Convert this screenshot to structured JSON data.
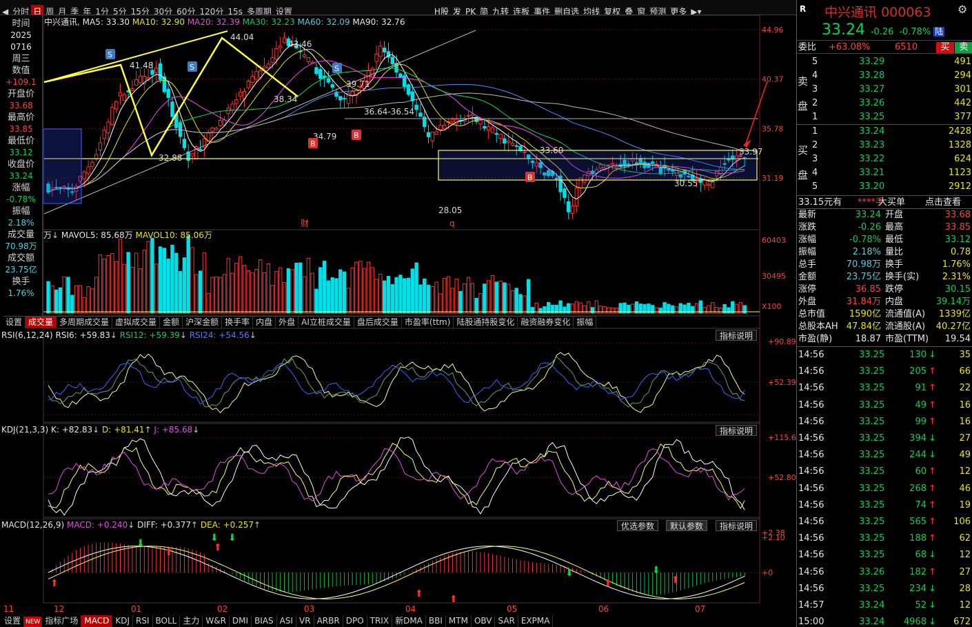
{
  "toolbar": {
    "left": [
      "分时",
      "日",
      "周",
      "月",
      "季",
      "年",
      "1分",
      "5分",
      "15分",
      "30分",
      "60分",
      "120分",
      "15s",
      "多周期",
      "设置"
    ],
    "right": [
      "H股",
      "发",
      "PK",
      "简",
      "九转",
      "连板",
      "事件",
      "删自选",
      "均线",
      "复权",
      "叠",
      "窗",
      "预测",
      "更多"
    ]
  },
  "chart_header": {
    "name": "中兴通讯",
    "ma5": "MA5: 33.30",
    "ma10": "MA10: 32.90",
    "ma20": "MA20: 32.39",
    "ma30": "MA30: 32.23",
    "ma60": "MA60: 32.09",
    "ma90": "MA90: 32.76"
  },
  "left_panel": [
    {
      "label": "时间",
      "value": "",
      "cls": "white"
    },
    {
      "label": "",
      "value": "2025",
      "cls": "white"
    },
    {
      "label": "",
      "value": "0716",
      "cls": "white"
    },
    {
      "label": "周三",
      "value": "",
      "cls": "white"
    },
    {
      "label": "数值",
      "value": "",
      "cls": "white"
    },
    {
      "label": "",
      "value": "+109.1",
      "cls": "red"
    },
    {
      "label": "开盘价",
      "value": "",
      "cls": "white"
    },
    {
      "label": "",
      "value": "33.68",
      "cls": "red"
    },
    {
      "label": "最高价",
      "value": "",
      "cls": "white"
    },
    {
      "label": "",
      "value": "33.85",
      "cls": "red"
    },
    {
      "label": "最低价",
      "value": "",
      "cls": "white"
    },
    {
      "label": "",
      "value": "33.12",
      "cls": "green"
    },
    {
      "label": "收盘价",
      "value": "",
      "cls": "white"
    },
    {
      "label": "",
      "value": "33.24",
      "cls": "green"
    },
    {
      "label": "涨幅",
      "value": "",
      "cls": "white"
    },
    {
      "label": "",
      "value": "-0.78%",
      "cls": "green"
    },
    {
      "label": "振幅",
      "value": "",
      "cls": "white"
    },
    {
      "label": "",
      "value": "2.18%",
      "cls": "cyan"
    },
    {
      "label": "成交量",
      "value": "",
      "cls": "white"
    },
    {
      "label": "",
      "value": "70.98万",
      "cls": "cyan"
    },
    {
      "label": "成交额",
      "value": "",
      "cls": "white"
    },
    {
      "label": "",
      "value": "23.75亿",
      "cls": "cyan"
    },
    {
      "label": "换手",
      "value": "",
      "cls": "white"
    },
    {
      "label": "",
      "value": "1.76%",
      "cls": "cyan"
    }
  ],
  "price_axis": [
    "44.96",
    "40.37",
    "35.78",
    "31.19"
  ],
  "annotations": {
    "high1": "41.48",
    "high2": "44.04",
    "high3": "43.46",
    "low1": "32.88",
    "low2": "38.34",
    "low3": "34.79",
    "mid1": "39.71",
    "range": "36.64-36.54",
    "box_top": "33.60",
    "low4": "28.05",
    "low5": "30.55",
    "last": "33.97",
    "cai": "财",
    "q": "q"
  },
  "vol": {
    "header_unit": "万",
    "mavol5": "MAVOL5: 85.68万",
    "mavol10": "MAVOL10: 85.06万",
    "axis": [
      "60403",
      "30495",
      "X100"
    ]
  },
  "ind_tabs": [
    "设置",
    "成交量",
    "多周期成交量",
    "虚拟成交量",
    "金额",
    "沪深金额",
    "换手率",
    "内盘",
    "外盘",
    "AI立桩成交量",
    "盘后成交量",
    "市盈率(ttm)",
    "陆股通持股变化",
    "融资融券变化",
    "振幅"
  ],
  "rsi": {
    "title": "RSI(6,12,24)",
    "rsi6": "RSI6: +59.83",
    "rsi12": "RSI12: +59.39",
    "rsi24": "RSI24: +54.56",
    "btn": "指标说明",
    "axis": [
      "+90.89",
      "+52.39"
    ]
  },
  "kdj": {
    "title": "KDJ(21,3,3)",
    "k": "K: +82.83",
    "d": "D: +81.41",
    "j": "J: +85.68",
    "btn": "指标说明",
    "axis": [
      "+115.6",
      "+52.80"
    ]
  },
  "macd": {
    "title": "MACD(12,26,9)",
    "macd": "MACD: +0.240",
    "diff": "DIFF: +0.377",
    "dea": "DEA: +0.257",
    "btns": [
      "优选参数",
      "默认参数",
      "指标说明"
    ],
    "axis": [
      "+2.38",
      "+2.10",
      "+0"
    ]
  },
  "months": [
    "11",
    "12",
    "01",
    "02",
    "03",
    "04",
    "05",
    "06",
    "07"
  ],
  "bot_tabs": [
    "设置",
    "指标广场",
    "MACD",
    "KDJ",
    "RSI",
    "BOLL",
    "主力",
    "W&R",
    "DMI",
    "BIAS",
    "ASI",
    "VR",
    "ARBR",
    "DPO",
    "TRIX",
    "新DMA",
    "BBI",
    "MTM",
    "OBV",
    "SAR",
    "EXPMA"
  ],
  "new_badge": "NEW",
  "stock": {
    "r": "R",
    "name": "中兴通讯",
    "code": "000063",
    "price": "33.24",
    "chg": "-0.26",
    "pct": "-0.78%",
    "tag": "陆",
    "wb_label": "委比",
    "wb": "+63.08%",
    "wc": "6510",
    "buy": "买",
    "sell": "卖"
  },
  "asks": [
    {
      "n": "5",
      "p": "33.29",
      "v": "491"
    },
    {
      "n": "4",
      "p": "33.28",
      "v": "294"
    },
    {
      "n": "3",
      "p": "33.27",
      "v": "301"
    },
    {
      "n": "2",
      "p": "33.26",
      "v": "442"
    },
    {
      "n": "1",
      "p": "33.25",
      "v": "377"
    }
  ],
  "bids": [
    {
      "n": "1",
      "p": "33.24",
      "v": "2428"
    },
    {
      "n": "2",
      "p": "33.23",
      "v": "1328"
    },
    {
      "n": "3",
      "p": "33.22",
      "v": "624"
    },
    {
      "n": "4",
      "p": "33.21",
      "v": "1123"
    },
    {
      "n": "5",
      "p": "33.20",
      "v": "2912"
    }
  ],
  "ask_side": [
    "卖",
    "盘"
  ],
  "bid_side": [
    "买",
    "盘"
  ],
  "bigorder": {
    "a": "33.15元有",
    "b": "****手",
    "c": "大买单",
    "d": "点击查看"
  },
  "stats": [
    [
      "最新",
      "33.24",
      "green",
      "开盘",
      "33.68",
      "red"
    ],
    [
      "涨跌",
      "-0.26",
      "green",
      "最高",
      "33.85",
      "red"
    ],
    [
      "涨幅",
      "-0.78%",
      "green",
      "最低",
      "33.12",
      "green"
    ],
    [
      "振幅",
      "2.18%",
      "cyan",
      "量比",
      "0.78",
      "yellow"
    ],
    [
      "总手",
      "70.98万",
      "cyan",
      "换手",
      "1.76%",
      "yellow"
    ],
    [
      "金额",
      "23.75亿",
      "cyan",
      "换手(实)",
      "2.31%",
      "yellow"
    ],
    [
      "涨停",
      "36.85",
      "red",
      "跌停",
      "30.15",
      "green"
    ],
    [
      "外盘",
      "31.84万",
      "red",
      "内盘",
      "39.14万",
      "green"
    ],
    [
      "总市值",
      "1590亿",
      "yellow",
      "流通值(A)",
      "1339亿",
      "yellow"
    ],
    [
      "总股本AH",
      "47.84亿",
      "yellow",
      "流通股(A)",
      "40.27亿",
      "yellow"
    ],
    [
      "市盈(静)",
      "18.87",
      "white",
      "市盈(TTM)",
      "19.54",
      "white"
    ]
  ],
  "ticks": [
    {
      "t": "14:56",
      "p": "33.25",
      "v": "130",
      "d": "down",
      "n": "35"
    },
    {
      "t": "14:56",
      "p": "33.25",
      "v": "205",
      "d": "up",
      "n": "66"
    },
    {
      "t": "14:56",
      "p": "33.25",
      "v": "91",
      "d": "up",
      "n": "22"
    },
    {
      "t": "14:56",
      "p": "33.25",
      "v": "49",
      "d": "up",
      "n": "16"
    },
    {
      "t": "14:56",
      "p": "33.25",
      "v": "99",
      "d": "up",
      "n": "16"
    },
    {
      "t": "14:56",
      "p": "33.25",
      "v": "394",
      "d": "down",
      "n": "27"
    },
    {
      "t": "14:56",
      "p": "33.25",
      "v": "244",
      "d": "down",
      "n": "49"
    },
    {
      "t": "14:56",
      "p": "33.25",
      "v": "60",
      "d": "up",
      "n": "12"
    },
    {
      "t": "14:56",
      "p": "33.25",
      "v": "268",
      "d": "up",
      "n": "46"
    },
    {
      "t": "14:56",
      "p": "33.25",
      "v": "74",
      "d": "up",
      "n": "19"
    },
    {
      "t": "14:56",
      "p": "33.25",
      "v": "565",
      "d": "up",
      "n": "106"
    },
    {
      "t": "14:56",
      "p": "33.25",
      "v": "188",
      "d": "up",
      "n": "62"
    },
    {
      "t": "14:56",
      "p": "33.25",
      "v": "68",
      "d": "down",
      "n": "12"
    },
    {
      "t": "14:56",
      "p": "33.26",
      "v": "182",
      "d": "up",
      "n": "27"
    },
    {
      "t": "14:56",
      "p": "33.25",
      "v": "234",
      "d": "down",
      "n": "28"
    },
    {
      "t": "14:57",
      "p": "33.24",
      "v": "52",
      "d": "down",
      "n": "12"
    },
    {
      "t": "15:00",
      "p": "33.24",
      "v": "4968",
      "d": "down",
      "n": "672"
    }
  ],
  "colors": {
    "up": "#ff3030",
    "down": "#00e0e8",
    "ma5": "#ffffff",
    "ma10": "#e8e800",
    "ma20": "#ff40ff",
    "ma30": "#00e060",
    "ma60": "#4f8cff",
    "ma90": "#bbbbbb"
  }
}
